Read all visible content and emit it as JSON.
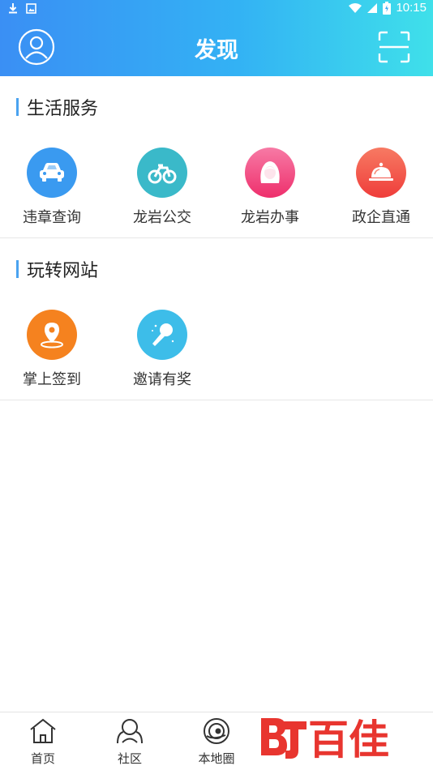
{
  "status_bar": {
    "time": "10:15"
  },
  "header": {
    "title": "发现",
    "avatar_icon": "user-avatar-icon",
    "scan_icon": "scan-icon"
  },
  "sections": [
    {
      "title": "生活服务",
      "items": [
        {
          "label": "违章查询",
          "icon": "car-icon",
          "color": "#3a9af0"
        },
        {
          "label": "龙岩公交",
          "icon": "bus-bike-icon",
          "color": "#3ab9c9"
        },
        {
          "label": "龙岩办事",
          "icon": "person-icon",
          "color": "#f0457d"
        },
        {
          "label": "政企直通",
          "icon": "service-bell-icon",
          "color": "#f2574e"
        }
      ]
    },
    {
      "title": "玩转网站",
      "items": [
        {
          "label": "掌上签到",
          "icon": "location-pin-icon",
          "color": "#f5821f"
        },
        {
          "label": "邀请有奖",
          "icon": "microphone-icon",
          "color": "#3dbde9"
        }
      ]
    }
  ],
  "tabbar": {
    "items": [
      {
        "label": "首页",
        "icon": "home-icon"
      },
      {
        "label": "社区",
        "icon": "community-icon"
      },
      {
        "label": "本地圈",
        "icon": "local-circle-icon"
      }
    ]
  },
  "watermark": {
    "text": "百佳",
    "color": "#e8352f"
  }
}
